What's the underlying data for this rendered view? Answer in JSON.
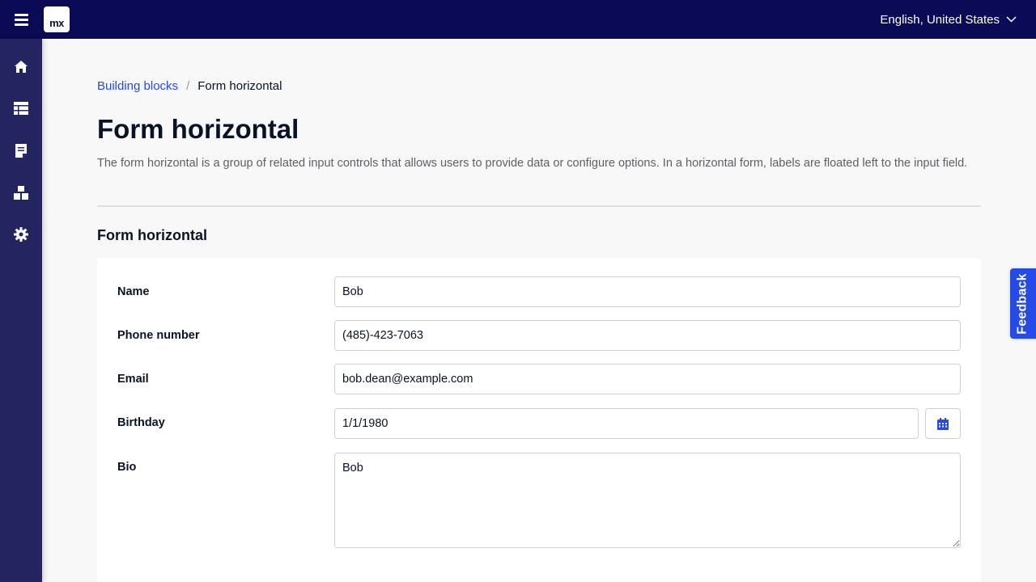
{
  "topbar": {
    "logo_text": "mx",
    "language": "English, United States"
  },
  "sidebar": {
    "items": [
      {
        "icon": "home-icon"
      },
      {
        "icon": "table-icon"
      },
      {
        "icon": "document-icon"
      },
      {
        "icon": "blocks-icon"
      },
      {
        "icon": "gear-icon"
      }
    ]
  },
  "breadcrumb": {
    "parent": "Building blocks",
    "separator": "/",
    "current": "Form horizontal"
  },
  "page": {
    "title": "Form horizontal",
    "description": "The form horizontal is a group of related input controls that allows users to provide data or configure options. In a horizontal form, labels are floated left to the input field."
  },
  "section": {
    "title": "Form horizontal"
  },
  "form": {
    "name_label": "Name",
    "name_value": "Bob",
    "phone_label": "Phone number",
    "phone_value": "(485)-423-7063",
    "email_label": "Email",
    "email_value": "bob.dean@example.com",
    "birthday_label": "Birthday",
    "birthday_value": "1/1/1980",
    "bio_label": "Bio",
    "bio_value": "Bob"
  },
  "feedback": {
    "label": "Feedback"
  },
  "colors": {
    "topbar": "#0a0a55",
    "sidebar": "#242460",
    "accent": "#264ae5"
  }
}
